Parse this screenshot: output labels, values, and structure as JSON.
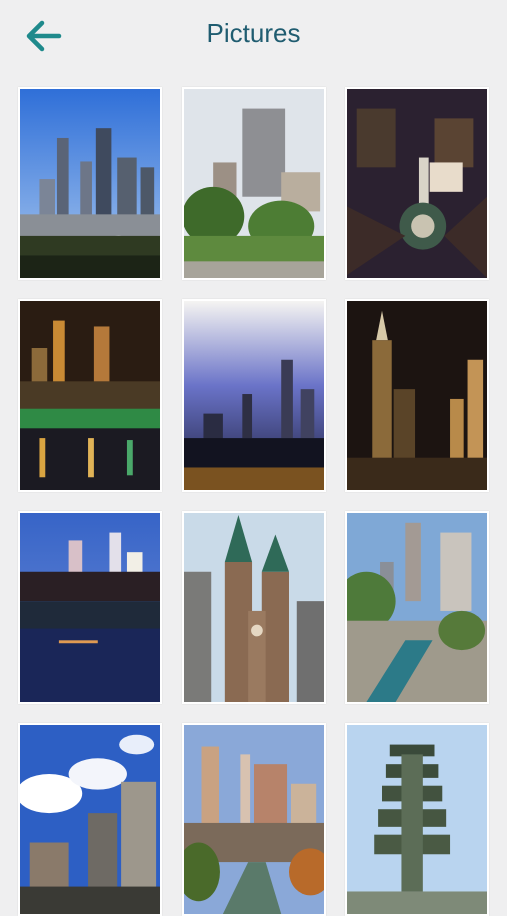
{
  "header": {
    "title": "Pictures",
    "back_icon": "arrow-left-icon",
    "accent_color": "#1f8a8c"
  },
  "gallery": {
    "items": [
      {
        "name": "picture-1"
      },
      {
        "name": "picture-2"
      },
      {
        "name": "picture-3"
      },
      {
        "name": "picture-4"
      },
      {
        "name": "picture-5"
      },
      {
        "name": "picture-6"
      },
      {
        "name": "picture-7"
      },
      {
        "name": "picture-8"
      },
      {
        "name": "picture-9"
      },
      {
        "name": "picture-10"
      },
      {
        "name": "picture-11"
      },
      {
        "name": "picture-12"
      }
    ]
  }
}
